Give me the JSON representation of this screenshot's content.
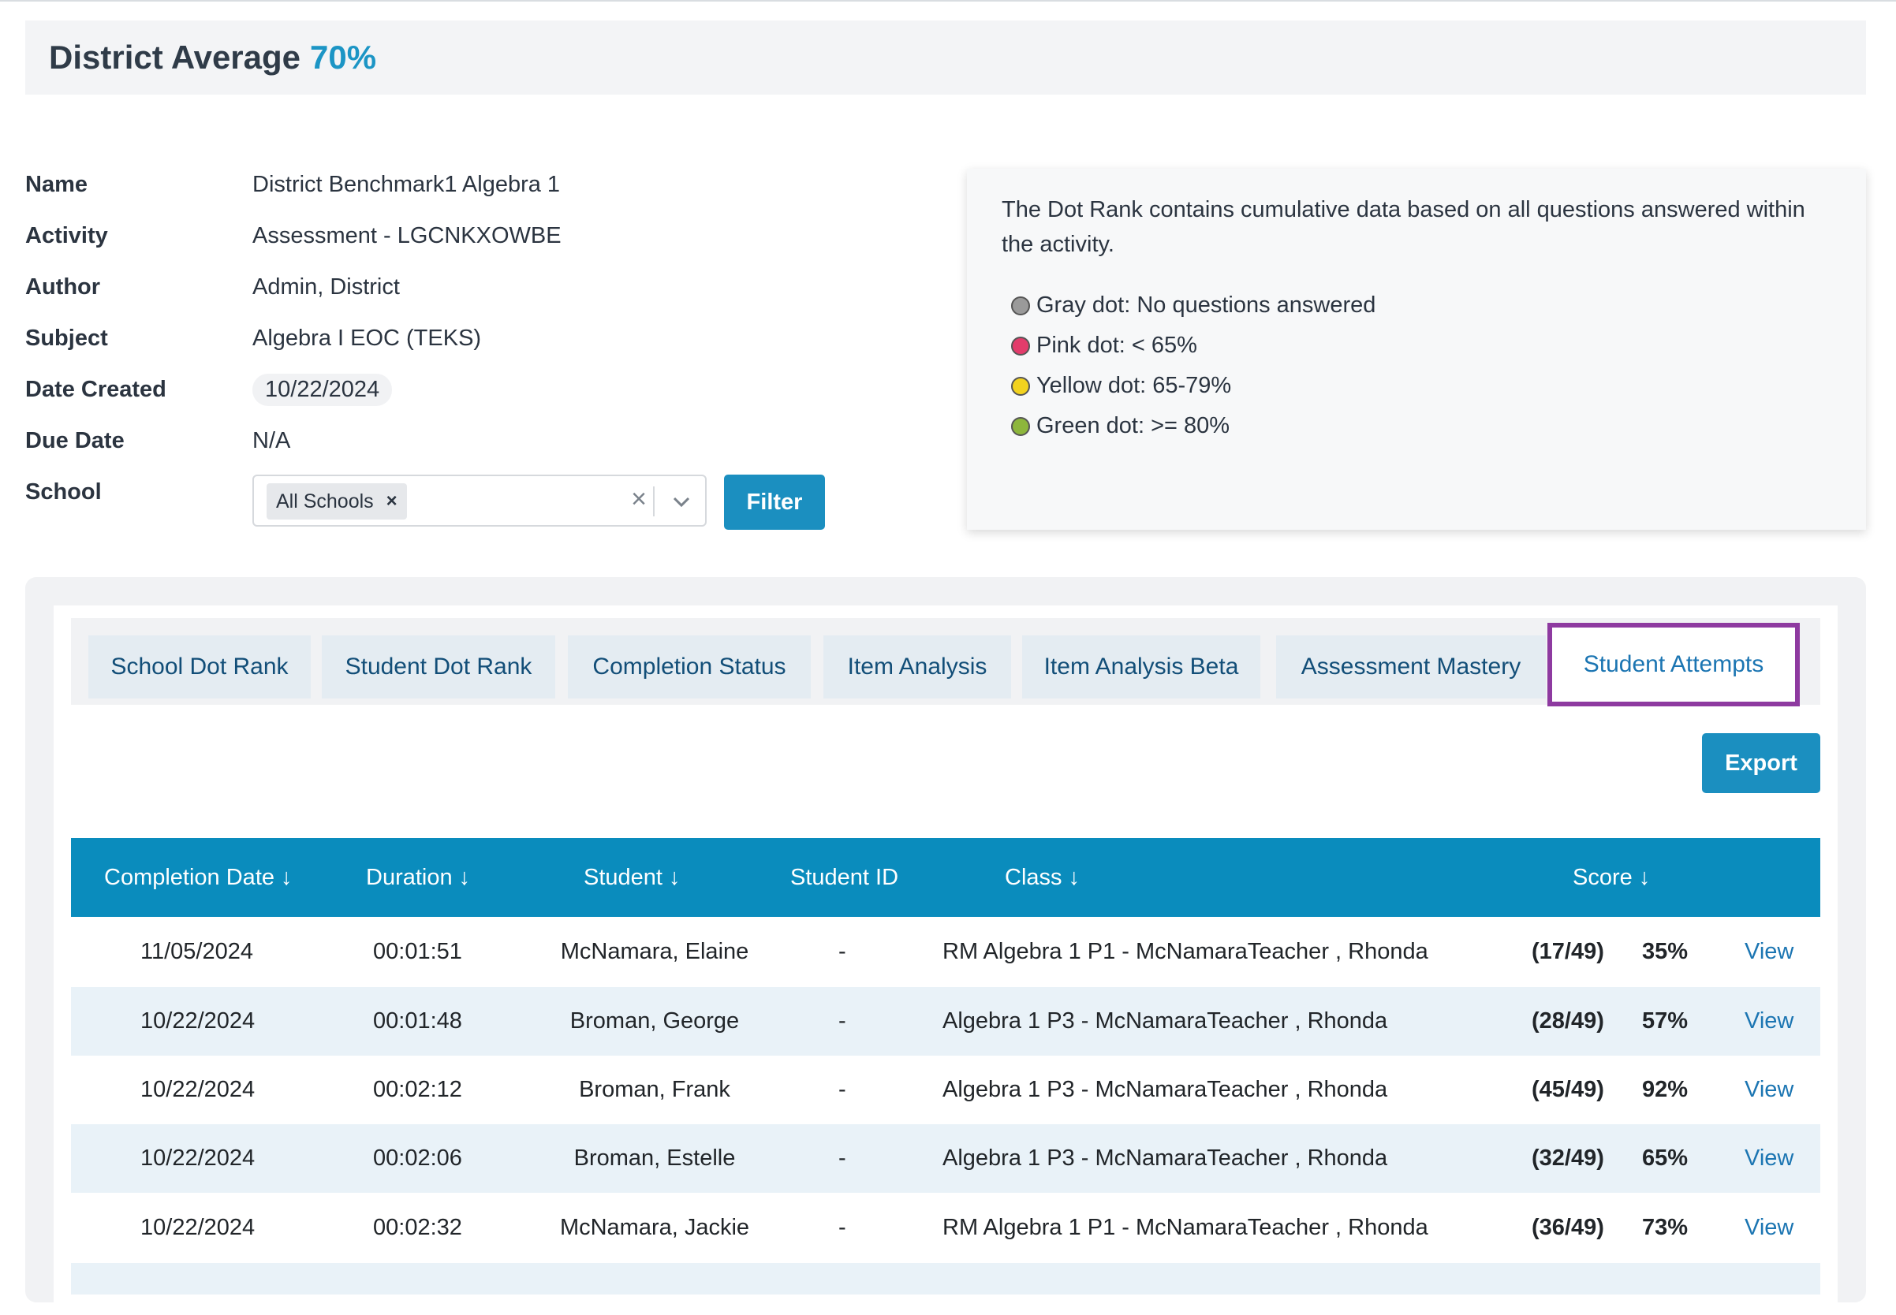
{
  "header": {
    "label": "District Average",
    "value": "70%"
  },
  "info": {
    "name_label": "Name",
    "name_value": "District Benchmark1 Algebra 1",
    "activity_label": "Activity",
    "activity_value": "Assessment - LGCNKXOWBE",
    "author_label": "Author",
    "author_value": "Admin, District",
    "subject_label": "Subject",
    "subject_value": "Algebra I EOC (TEKS)",
    "date_created_label": "Date Created",
    "date_created_value": "10/22/2024",
    "due_date_label": "Due Date",
    "due_date_value": "N/A",
    "school_label": "School",
    "school_chip": "All Schools",
    "filter_label": "Filter"
  },
  "legend": {
    "description": "The Dot Rank contains cumulative data based on all questions answered within the activity.",
    "items": [
      {
        "label": "Gray dot: No questions answered",
        "color": "#9a9a9a"
      },
      {
        "label": "Pink dot: < 65%",
        "color": "#e23c6b"
      },
      {
        "label": "Yellow dot: 65-79%",
        "color": "#f2d21f"
      },
      {
        "label": "Green dot: >= 80%",
        "color": "#8db63c"
      }
    ]
  },
  "tabs": [
    {
      "label": "School Dot Rank"
    },
    {
      "label": "Student Dot Rank"
    },
    {
      "label": "Completion Status"
    },
    {
      "label": "Item Analysis"
    },
    {
      "label": "Item Analysis Beta"
    },
    {
      "label": "Assessment Mastery"
    },
    {
      "label": "Student Attempts",
      "active": true
    }
  ],
  "export_label": "Export",
  "table": {
    "headers": [
      "Completion Date ↓",
      "Duration ↓",
      "Student ↓",
      "Student ID",
      "Class ↓",
      "Score ↓"
    ],
    "rows": [
      {
        "date": "11/05/2024",
        "duration": "00:01:51",
        "student": "McNamara, Elaine",
        "student_id": "-",
        "class": "RM Algebra 1 P1 - McNamaraTeacher , Rhonda",
        "fraction": "(17/49)",
        "percent": "35%",
        "action": "View"
      },
      {
        "date": "10/22/2024",
        "duration": "00:01:48",
        "student": "Broman, George",
        "student_id": "-",
        "class": "Algebra 1 P3 - McNamaraTeacher , Rhonda",
        "fraction": "(28/49)",
        "percent": "57%",
        "action": "View"
      },
      {
        "date": "10/22/2024",
        "duration": "00:02:12",
        "student": "Broman, Frank",
        "student_id": "-",
        "class": "Algebra 1 P3 - McNamaraTeacher , Rhonda",
        "fraction": "(45/49)",
        "percent": "92%",
        "action": "View"
      },
      {
        "date": "10/22/2024",
        "duration": "00:02:06",
        "student": "Broman, Estelle",
        "student_id": "-",
        "class": "Algebra 1 P3 - McNamaraTeacher , Rhonda",
        "fraction": "(32/49)",
        "percent": "65%",
        "action": "View"
      },
      {
        "date": "10/22/2024",
        "duration": "00:02:32",
        "student": "McNamara, Jackie",
        "student_id": "-",
        "class": "RM Algebra 1 P1 - McNamaraTeacher , Rhonda",
        "fraction": "(36/49)",
        "percent": "73%",
        "action": "View"
      }
    ]
  },
  "colors": {
    "accent": "#1b8fc0",
    "table_header": "#0a8cbd",
    "active_tab_border": "#8e3aa0",
    "link": "#1b75b2"
  }
}
